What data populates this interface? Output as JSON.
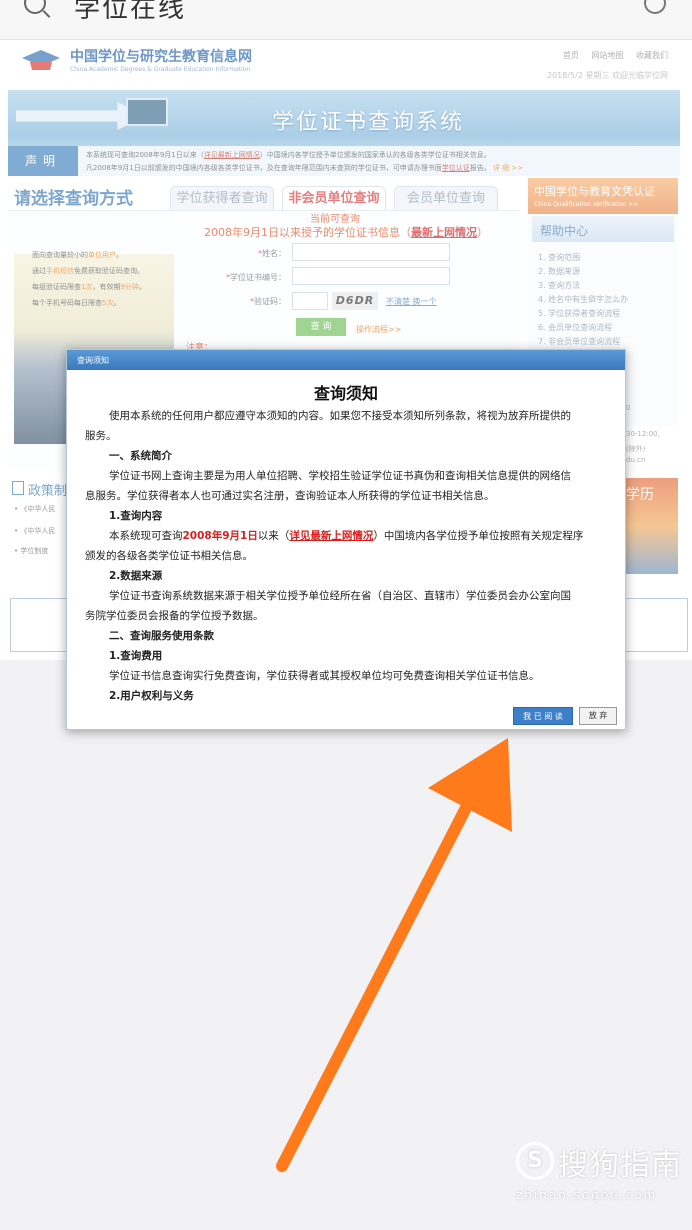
{
  "search": {
    "text": "学位在线"
  },
  "site": {
    "name": "中国学位与研究生教育信息网",
    "name_en": "China Academic Degrees & Graduate Education Information",
    "links": [
      "首页",
      "网站地图",
      "收藏我们"
    ],
    "date_line": "2018/5/2 星期三  欢迎光临学位网",
    "banner_title": "学位证书查询系统",
    "notice_tag": "声明",
    "notice_line1_a": "本系统现可查询2008年9月1日以来（",
    "notice_line1_link": "详见最新上网情况",
    "notice_line1_b": "）中国境内各学位授予单位颁发的国家承认的各级各类学位证书相关信息。",
    "notice_line2_a": "凡2008年9月1日以前颁发的中国境内各级各类学位证书，及在查询年限范围内未查到的学位证书，可申请办理书面",
    "notice_line2_link": "学位认证",
    "notice_line2_b": "报告。",
    "notice_line2_more": "详 细 >>",
    "method_title": "请选择查询方式",
    "tabs": [
      "学位获得者查询",
      "非会员单位查询",
      "会员单位查询"
    ],
    "current_query": "当前可查询",
    "since_a": "2008年9月1日以来授予的学位证书信息（",
    "since_link": "最新上网情况",
    "since_b": "）",
    "promo_lines": [
      {
        "a": "面向查询量较小的",
        "em": "单位用户",
        "b": "。"
      },
      {
        "a": "通过",
        "em": "手机短信",
        "b": "免费获取验证码查询。"
      },
      {
        "a": "每组验证码限查",
        "em": "1次",
        "b": "，有效期",
        "em2": "9分钟",
        "c": "。"
      },
      {
        "a": "每个手机号码每日限查",
        "em": "5次",
        "b": "。"
      }
    ],
    "fields": [
      "姓名：",
      "学位证书编号：",
      "验证码："
    ],
    "captcha": "D6DR",
    "captcha_link": "不清楚 换一个",
    "query_btn": "查 询",
    "flow_link": "操作流程>>",
    "note_label": "注意：",
    "cert_title": "中国学位与教育文凭认证",
    "cert_en": "China Qualification Verification >>",
    "help_title": "帮助中心",
    "help_items": [
      "1. 查询范围",
      "2. 数据来源",
      "3. 查询方法",
      "4. 姓名中有生僻字怎么办",
      "5. 学位获得者查询流程",
      "6. 会员单位查询流程",
      "7. 非会员单位查询流程"
    ],
    "side_misc": [
      "0",
      "30-12:00,",
      "(除外)",
      "du.cn"
    ],
    "policy_title": "政策制",
    "policy_items": [
      "《中华人民",
      "《中华人民",
      "学位制度"
    ],
    "right_img_text": "学历"
  },
  "modal": {
    "header": "查询须知",
    "title": "查询须知",
    "p1_l1": "使用本系统的任何用户都应遵守本须知的内容。如果您不接受本须知所列条款，将视为放弃所提供的",
    "p1_l2": "服务。",
    "s1": "一、系统简介",
    "s1_l1": "学位证书网上查询主要是为用人单位招聘、学校招生验证学位证书真伪和查询相关信息提供的网络信",
    "s1_l2": "息服务。学位获得者本人也可通过实名注册，查询验证本人所获得的学位证书相关信息。",
    "s1_1": "1.查询内容",
    "s1_1_a": "本系统现可查询",
    "s1_1_red": "2008年9月1日",
    "s1_1_b": "以来（",
    "s1_1_link": "详见最新上网情况",
    "s1_1_c": "）中国境内各学位授予单位按照有关规定程序",
    "s1_1_l2": "颁发的各级各类学位证书相关信息。",
    "s1_2": "2.数据来源",
    "s1_2_l1": "学位证书查询系统数据来源于相关学位授予单位经所在省（自治区、直辖市）学位委员会办公室向国",
    "s1_2_l2": "务院学位委员会报备的学位授予数据。",
    "s2": "二、查询服务使用条款",
    "s2_1": "1.查询费用",
    "s2_1_l1": "学位证书信息查询实行免费查询，学位获得者或其授权单位均可免费查询相关学位证书信息。",
    "s2_2": "2.用户权利与义务",
    "btn_read": "我 已 阅 读",
    "btn_giveup": "放 弃"
  },
  "watermark": {
    "text": "搜狗指南",
    "url": "zhinan.sogou.com"
  },
  "colors": {
    "arrow": "#ff7a1a",
    "modal_header": "#3b78bd",
    "tab_active": "#d93a3a"
  }
}
